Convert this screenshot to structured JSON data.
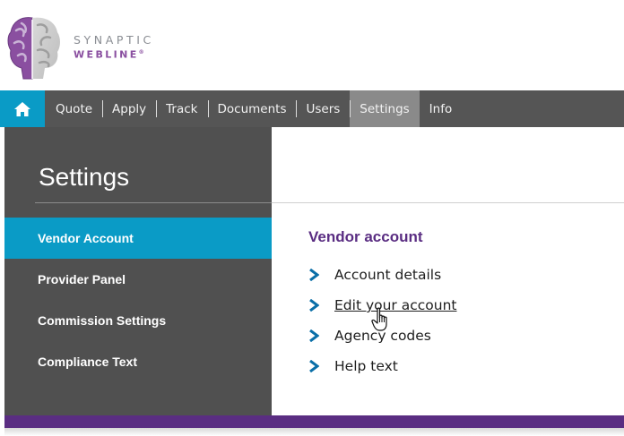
{
  "brand": {
    "line1": "SYNAPTIC",
    "line2": "WEBLINE",
    "mark": "®",
    "accent": "#8a4fa0"
  },
  "topnav": {
    "home_icon": "home-icon",
    "items": [
      "Quote",
      "Apply",
      "Track",
      "Documents",
      "Users",
      "Settings",
      "Info"
    ],
    "active": "Settings",
    "home_color": "#0a9bc6"
  },
  "sidebar": {
    "title": "Settings",
    "items": [
      "Vendor Account",
      "Provider Panel",
      "Commission Settings",
      "Compliance Text"
    ],
    "active": "Vendor Account"
  },
  "main": {
    "section_title": "Vendor account",
    "links": [
      "Account details",
      "Edit your account",
      "Agency codes",
      "Help text"
    ],
    "hovered": "Edit your account"
  },
  "colors": {
    "accent_blue": "#0a9bc6",
    "purple": "#5a2d82",
    "nav_bg": "#555555",
    "sidebar_bg": "#505050"
  }
}
